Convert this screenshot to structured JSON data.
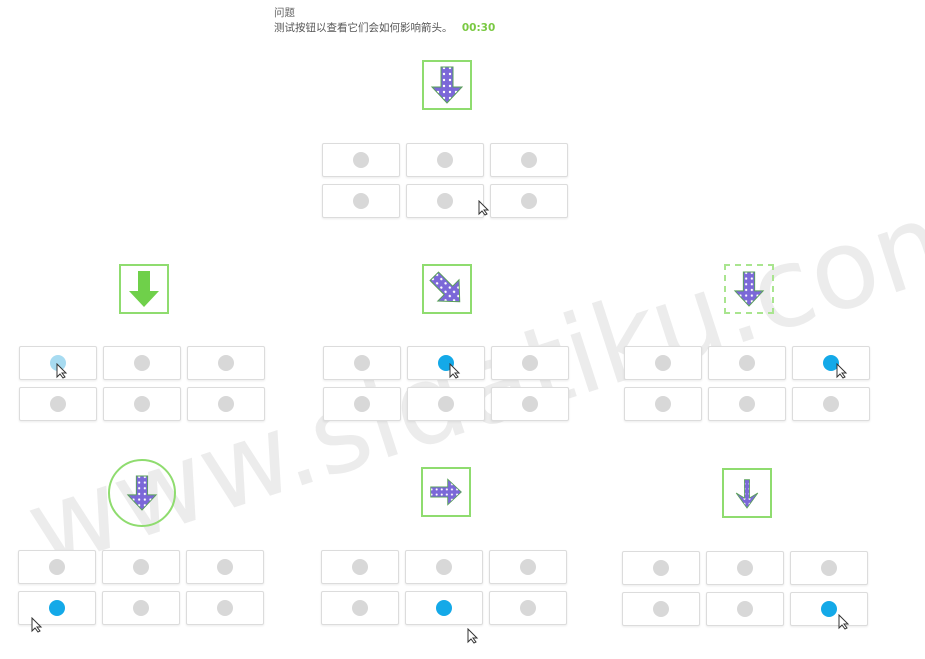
{
  "header": {
    "title": "问题",
    "instruction": "测试按钮以查看它们会如何影响箭头。",
    "timer": "00:30"
  },
  "watermark": "www.sidatiku.com",
  "colors": {
    "green": "#7ac943",
    "selected": "#14a9e8",
    "arrow": "#7b68d8"
  }
}
